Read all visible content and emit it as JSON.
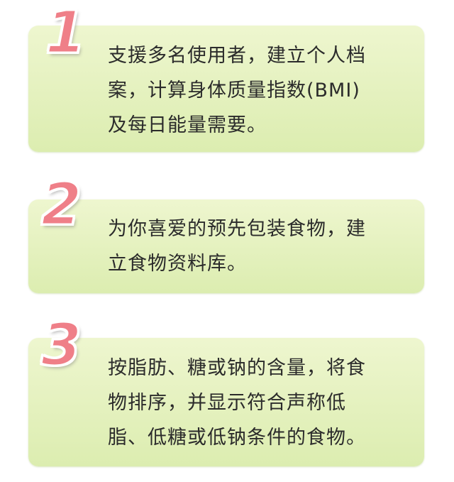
{
  "steps": [
    {
      "number": "1",
      "lines": [
        "支援多名使用者，建立个人档",
        "案，计算身体质量指数(BMI)",
        "及每日能量需要。"
      ]
    },
    {
      "number": "2",
      "lines": [
        "为你喜爱的预先包装食物，建",
        "立食物资料库。"
      ]
    },
    {
      "number": "3",
      "lines": [
        "按脂肪、糖或钠的含量，将食",
        "物排序，并显示符合声称低",
        "脂、低糖或低钠条件的食物。"
      ]
    }
  ],
  "colors": {
    "card_top": "#eef6cf",
    "card_bottom": "#dcedb0",
    "number_fill": "#ef7f88",
    "number_outline": "#ffffff",
    "text": "#2b2b2b"
  }
}
